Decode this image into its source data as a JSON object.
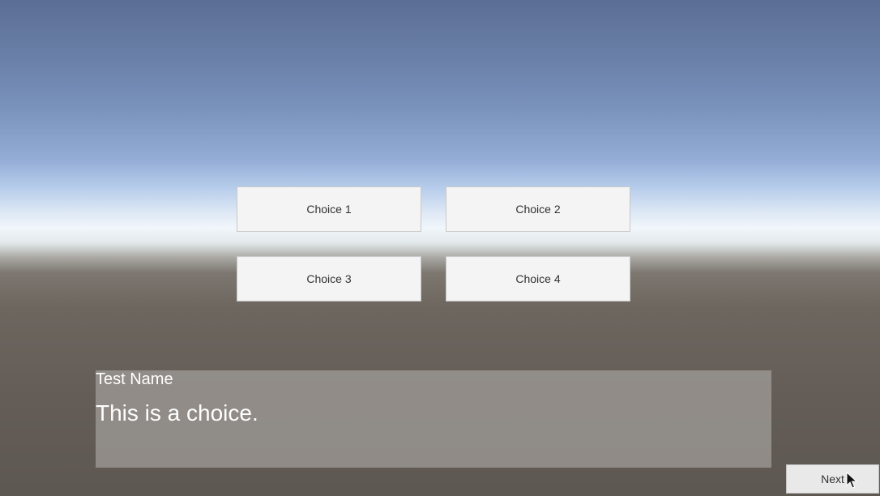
{
  "choices": {
    "c1": "Choice 1",
    "c2": "Choice 2",
    "c3": "Choice 3",
    "c4": "Choice 4"
  },
  "dialogue": {
    "speaker": "Test Name",
    "text": "This is a choice."
  },
  "next_label": "Next",
  "icons": {
    "cursor": "mouse-pointer-icon"
  }
}
